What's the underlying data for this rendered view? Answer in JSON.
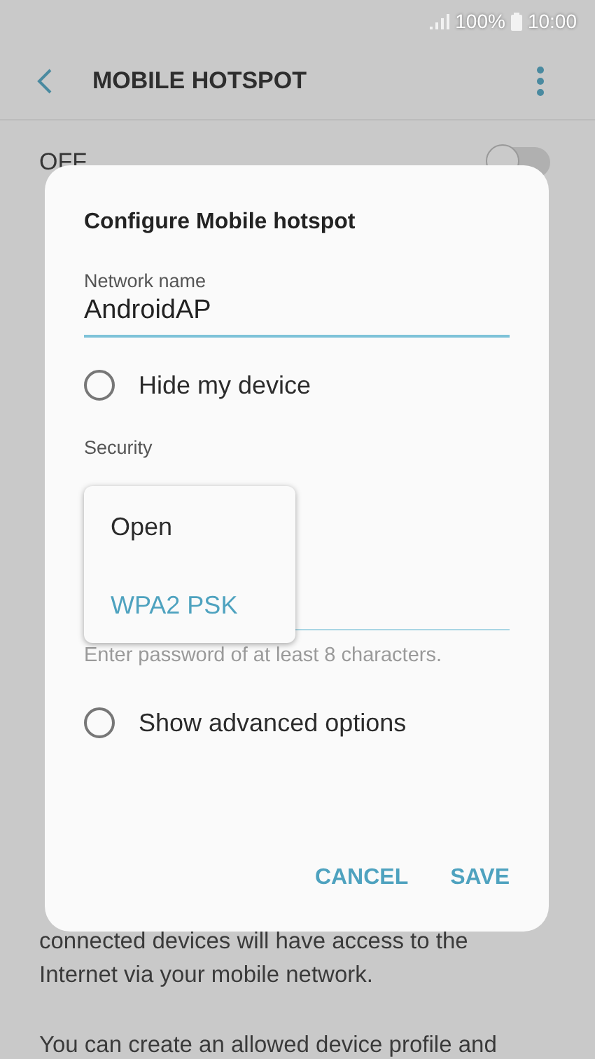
{
  "status_bar": {
    "battery": "100%",
    "time": "10:00"
  },
  "header": {
    "title": "MOBILE HOTSPOT"
  },
  "master_switch": {
    "label": "OFF",
    "on": false
  },
  "description": [
    "connected devices will have access to the Internet via your mobile network.",
    "You can create an allowed device profile and"
  ],
  "dialog": {
    "title": "Configure Mobile hotspot",
    "network_name": {
      "label": "Network name",
      "value": "AndroidAP"
    },
    "hide_device": {
      "label": "Hide my device",
      "checked": false
    },
    "security": {
      "label": "Security",
      "options": [
        {
          "label": "Open",
          "selected": false
        },
        {
          "label": "WPA2 PSK",
          "selected": true
        }
      ]
    },
    "password": {
      "hint": "Enter password of at least 8 characters."
    },
    "advanced": {
      "label": "Show advanced options",
      "checked": false
    },
    "buttons": [
      {
        "label": "CANCEL"
      },
      {
        "label": "SAVE"
      }
    ]
  }
}
